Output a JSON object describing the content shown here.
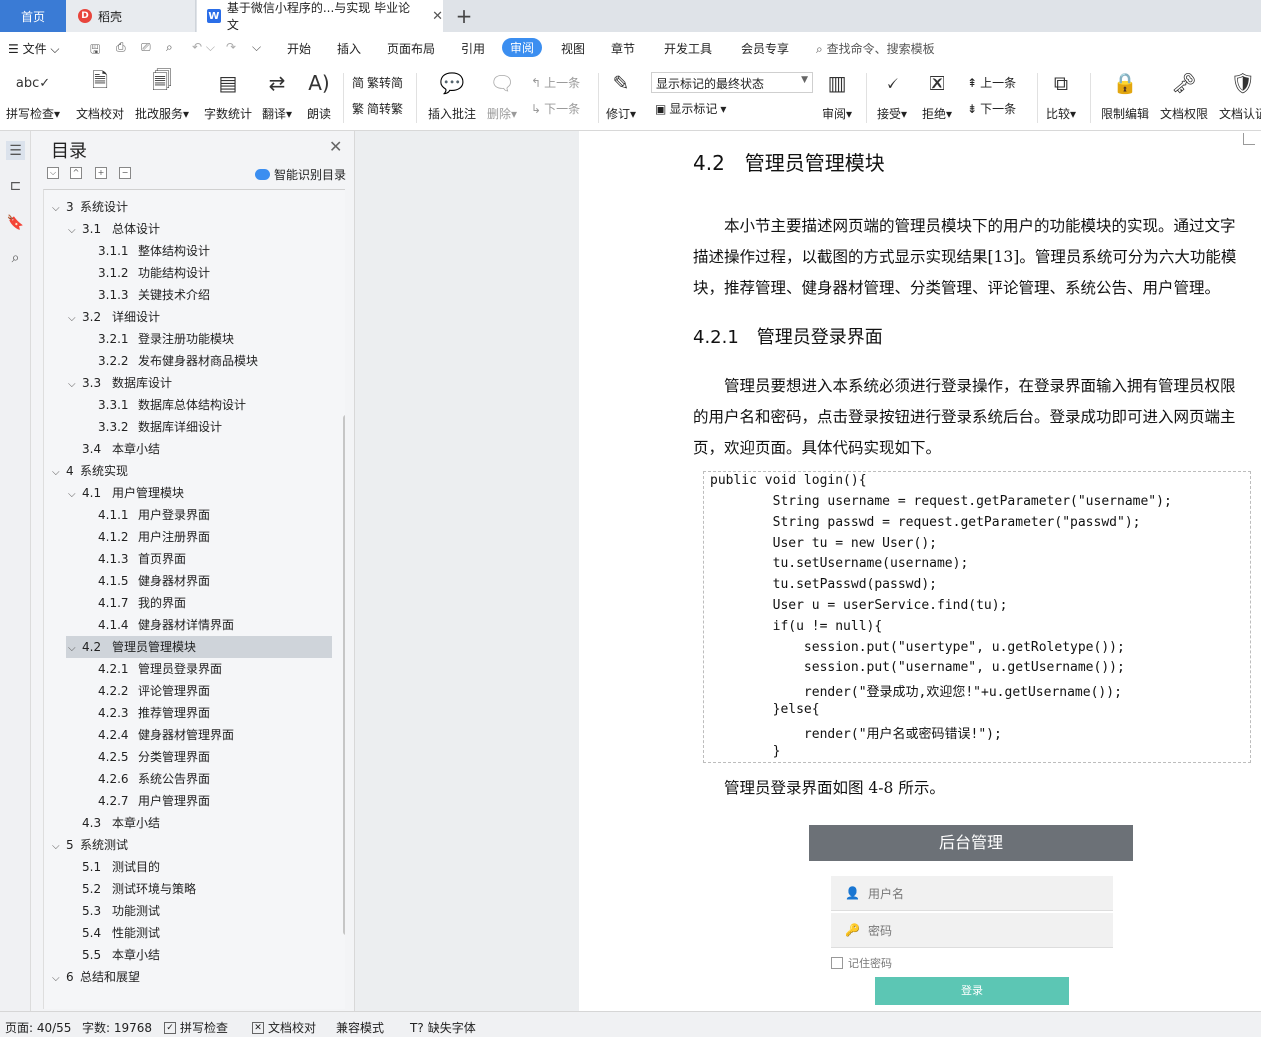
{
  "tabs": {
    "home": "首页",
    "daoke": "稻壳",
    "doc": "基于微信小程序的...与实现 毕业论文",
    "plus": "+"
  },
  "menu": {
    "file": "文件",
    "items": [
      "开始",
      "插入",
      "页面布局",
      "引用",
      "审阅",
      "视图",
      "章节",
      "开发工具",
      "会员专享"
    ],
    "search": "查找命令、搜索模板"
  },
  "ribbon": {
    "spell": "拼写检查",
    "proof": "文档校对",
    "correct": "批改服务",
    "wordcount": "字数统计",
    "translate": "翻译",
    "read": "朗读",
    "trad": "繁转简",
    "simp": "简转繁",
    "insert_comment": "插入批注",
    "delete": "删除",
    "prev": "上一条",
    "next": "下一条",
    "revise": "修订",
    "mark_state": "显示标记的最终状态",
    "show_mark": "显示标记",
    "review": "审阅",
    "accept": "接受",
    "reject": "拒绝",
    "prev2": "上一条",
    "next2": "下一条",
    "compare": "比较",
    "restrict": "限制编辑",
    "rights": "文档权限",
    "auth": "文档认证"
  },
  "toc": {
    "title": "目录",
    "smart": "智能识别目录",
    "items": [
      {
        "num": "3",
        "label": "系统设计",
        "level": 1,
        "arrow": true
      },
      {
        "num": "3.1",
        "label": "总体设计",
        "level": 2,
        "arrow": true
      },
      {
        "num": "3.1.1",
        "label": "整体结构设计",
        "level": 3
      },
      {
        "num": "3.1.2",
        "label": "功能结构设计",
        "level": 3
      },
      {
        "num": "3.1.3",
        "label": "关键技术介绍",
        "level": 3
      },
      {
        "num": "3.2",
        "label": "详细设计",
        "level": 2,
        "arrow": true
      },
      {
        "num": "3.2.1",
        "label": "登录注册功能模块",
        "level": 3
      },
      {
        "num": "3.2.2",
        "label": "发布健身器材商品模块",
        "level": 3
      },
      {
        "num": "3.3",
        "label": "数据库设计",
        "level": 2,
        "arrow": true
      },
      {
        "num": "3.3.1",
        "label": "数据库总体结构设计",
        "level": 3
      },
      {
        "num": "3.3.2",
        "label": "数据库详细设计",
        "level": 3
      },
      {
        "num": "3.4",
        "label": "本章小结",
        "level": 2
      },
      {
        "num": "4",
        "label": "系统实现",
        "level": 1,
        "arrow": true
      },
      {
        "num": "4.1",
        "label": "用户管理模块",
        "level": 2,
        "arrow": true
      },
      {
        "num": "4.1.1",
        "label": "用户登录界面",
        "level": 3
      },
      {
        "num": "4.1.2",
        "label": "用户注册界面",
        "level": 3
      },
      {
        "num": "4.1.3",
        "label": "首页界面",
        "level": 3
      },
      {
        "num": "4.1.5",
        "label": "健身器材界面",
        "level": 3
      },
      {
        "num": "4.1.7",
        "label": "我的界面",
        "level": 3
      },
      {
        "num": "4.1.4",
        "label": "健身器材详情界面",
        "level": 3
      },
      {
        "num": "4.2",
        "label": "管理员管理模块",
        "level": 2,
        "arrow": true,
        "selected": true
      },
      {
        "num": "4.2.1",
        "label": "管理员登录界面",
        "level": 3
      },
      {
        "num": "4.2.2",
        "label": "评论管理界面",
        "level": 3
      },
      {
        "num": "4.2.3",
        "label": "推荐管理界面",
        "level": 3
      },
      {
        "num": "4.2.4",
        "label": "健身器材管理界面",
        "level": 3
      },
      {
        "num": "4.2.5",
        "label": "分类管理界面",
        "level": 3
      },
      {
        "num": "4.2.6",
        "label": "系统公告界面",
        "level": 3
      },
      {
        "num": "4.2.7",
        "label": "用户管理界面",
        "level": 3
      },
      {
        "num": "4.3",
        "label": "本章小结",
        "level": 2
      },
      {
        "num": "5",
        "label": "系统测试",
        "level": 1,
        "arrow": true
      },
      {
        "num": "5.1",
        "label": "测试目的",
        "level": 2
      },
      {
        "num": "5.2",
        "label": "测试环境与策略",
        "level": 2
      },
      {
        "num": "5.3",
        "label": "功能测试",
        "level": 2
      },
      {
        "num": "5.4",
        "label": "性能测试",
        "level": 2
      },
      {
        "num": "5.5",
        "label": "本章小结",
        "level": 2
      },
      {
        "num": "6",
        "label": "总结和展望",
        "level": 1,
        "arrow": true
      }
    ]
  },
  "doc": {
    "h_42": "4.2　管理员管理模块",
    "p1": [
      "　　本小节主要描述网页端的管理员模块下的用户的功能模块的实现。通过文字",
      "描述操作过程，以截图的方式显示实现结果[13]。管理员系统可分为六大功能模",
      "块，推荐管理、健身器材管理、分类管理、评论管理、系统公告、用户管理。"
    ],
    "h_421": "4.2.1　管理员登录界面",
    "p2": [
      "　　管理员要想进入本系统必须进行登录操作，在登录界面输入拥有管理员权限",
      "的用户名和密码，点击登录按钮进行登录系统后台。登录成功即可进入网页端主",
      "页，欢迎页面。具体代码实现如下。"
    ],
    "code": [
      "public void login(){",
      "        String username = request.getParameter(\"username\");",
      "        String passwd = request.getParameter(\"passwd\");",
      "        User tu = new User();",
      "        tu.setUsername(username);",
      "        tu.setPasswd(passwd);",
      "        User u = userService.find(tu);",
      "        if(u != null){",
      "            session.put(\"usertype\", u.getRoletype());",
      "            session.put(\"username\", u.getUsername());",
      "            render(\"登录成功,欢迎您!\"+u.getUsername());",
      "        }else{",
      "            render(\"用户名或密码错误!\");",
      "        }"
    ],
    "caption": "　　管理员登录界面如图 4-8 所示。",
    "fig": {
      "title": "后台管理",
      "user_placeholder": "用户名",
      "pwd_placeholder": "密码",
      "remember": "记住密码",
      "login": "登录"
    }
  },
  "status": {
    "page": "页面: 40/55",
    "words": "字数: 19768",
    "spell": "拼写检查",
    "proof": "文档校对",
    "compat": "兼容模式",
    "font": "缺失字体"
  }
}
